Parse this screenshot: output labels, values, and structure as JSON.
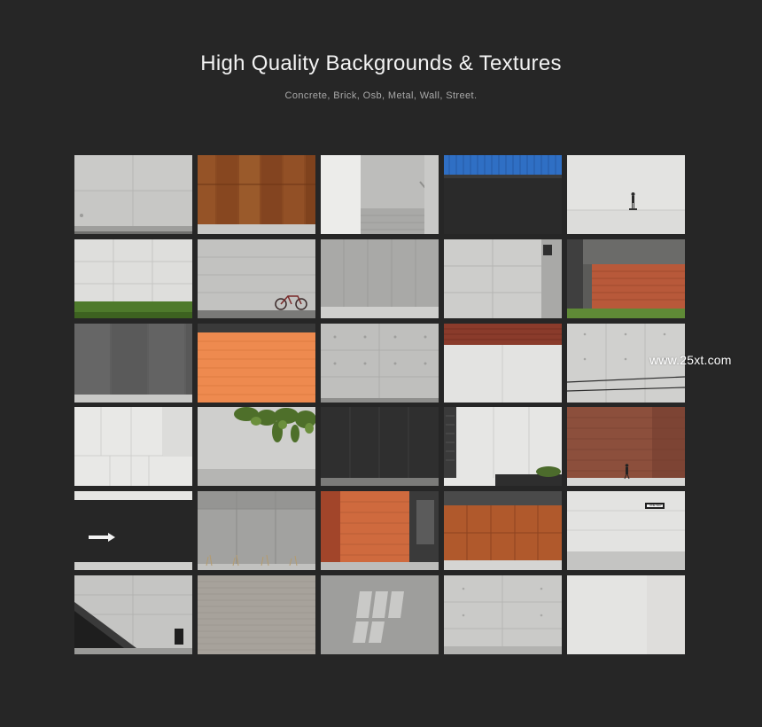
{
  "header": {
    "title": "High Quality Backgrounds & Textures",
    "subtitle": "Concrete, Brick, Osb, Metal, Wall, Street."
  },
  "watermark": "www.25xt.com",
  "tiles": [
    {
      "name": "concrete-wall-panels"
    },
    {
      "name": "corten-steel-panels"
    },
    {
      "name": "concrete-staircase"
    },
    {
      "name": "blue-container-dark-wall"
    },
    {
      "name": "skateboarder-plaza"
    },
    {
      "name": "white-panels-grass"
    },
    {
      "name": "concrete-wall-bicycle"
    },
    {
      "name": "grey-metal-facade"
    },
    {
      "name": "concrete-corner"
    },
    {
      "name": "red-brick-wall-lawn"
    },
    {
      "name": "dark-metal-panels"
    },
    {
      "name": "orange-tile-wall"
    },
    {
      "name": "formwork-concrete"
    },
    {
      "name": "brick-top-white-wall"
    },
    {
      "name": "concrete-with-wires"
    },
    {
      "name": "white-facade-panels"
    },
    {
      "name": "ivy-concrete-wall"
    },
    {
      "name": "black-panels"
    },
    {
      "name": "white-panel-planter"
    },
    {
      "name": "brick-wall-pedestrian"
    },
    {
      "name": "black-wall-arrow"
    },
    {
      "name": "grey-metal-panels-grass"
    },
    {
      "name": "brick-corner-building"
    },
    {
      "name": "corten-panels-facade"
    },
    {
      "name": "white-wall-one-way-sign"
    },
    {
      "name": "concrete-ramp-bin"
    },
    {
      "name": "brick-texture-grey"
    },
    {
      "name": "concrete-window-shadow"
    },
    {
      "name": "smooth-concrete-slab"
    },
    {
      "name": "plain-white-concrete"
    }
  ],
  "labels": {
    "one_way_sign": "ONE WAY"
  },
  "colors": {
    "background": "#262626",
    "title": "#f2f2f2",
    "subtitle": "#a9a9a9"
  }
}
